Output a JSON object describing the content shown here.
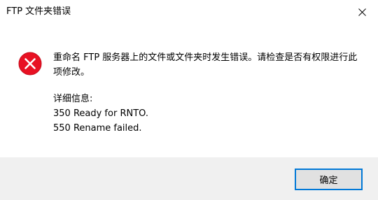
{
  "window": {
    "title": "FTP 文件夹错误"
  },
  "icons": {
    "close": "close-icon",
    "error": "error-icon"
  },
  "colors": {
    "error_red": "#e81123",
    "accent": "#0078d7",
    "footer_bg": "#f0f0f0",
    "button_bg": "#e1e1e1"
  },
  "message": {
    "main": "重命名 FTP 服务器上的文件或文件夹时发生错误。请检查是否有权限进行此项修改。",
    "details_label": "详细信息:",
    "details_lines": [
      "350 Ready for RNTO.",
      "550 Rename failed."
    ]
  },
  "buttons": {
    "ok_label": "确定"
  }
}
